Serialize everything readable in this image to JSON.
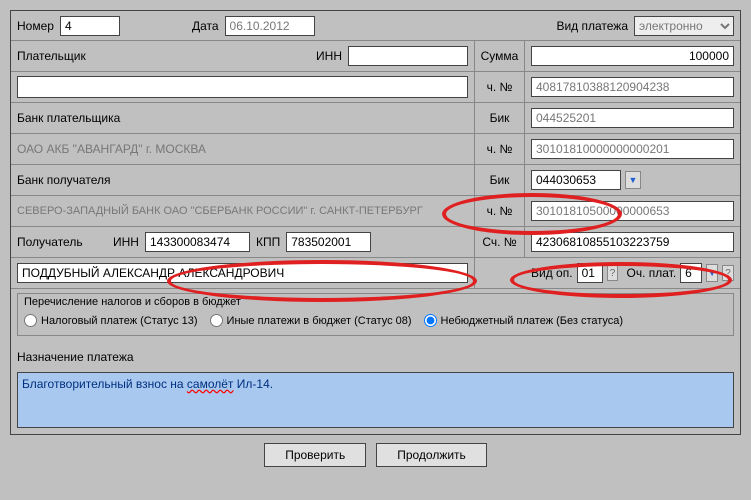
{
  "header": {
    "number_label": "Номер",
    "number": "4",
    "date_label": "Дата",
    "date": "06.10.2012",
    "type_label": "Вид платежа",
    "type": "электронно",
    "type_options": [
      "электронно"
    ]
  },
  "payer": {
    "label": "Плательщик",
    "inn_label": "ИНН",
    "inn": "",
    "amount_label": "Сумма",
    "amount": "100000",
    "account_label": "ч. №",
    "account": "40817810388120904238"
  },
  "payer_bank": {
    "label": "Банк плательщика",
    "name": "ОАО АКБ \"АВАНГАРД\" г. МОСКВА",
    "bik_label": "Бик",
    "bik": "044525201",
    "account_label": "ч. №",
    "account": "30101810000000000201"
  },
  "recipient_bank": {
    "label": "Банк получателя",
    "name": "СЕВЕРО-ЗАПАДНЫЙ БАНК ОАО \"СБЕРБАНК РОССИИ\" г. САНКТ-ПЕТЕРБУРГ",
    "bik_label": "Бик",
    "bik": "044030653",
    "account_label": "ч. №",
    "account": "30101810500000000653"
  },
  "recipient": {
    "label": "Получатель",
    "inn_label": "ИНН",
    "inn": "143300083474",
    "kpp_label": "КПП",
    "kpp": "783502001",
    "account_label": "Сч. №",
    "account": "42306810855103223759",
    "name": "ПОДДУБНЫЙ АЛЕКСАНДР АЛЕКСАНДРОВИЧ",
    "vid_op_label": "Вид оп.",
    "vid_op": "01",
    "och_plat_label": "Оч. плат.",
    "och_plat": "6"
  },
  "tax": {
    "group_label": "Перечисление налогов и сборов в бюджет",
    "opt1": "Налоговый платеж (Статус 13)",
    "opt2": "Иные платежи в бюджет (Статус 08)",
    "opt3": "Небюджетный платеж (Без статуса)"
  },
  "purpose": {
    "label": "Назначение платежа",
    "text_prefix": "Благотворительный взнос на ",
    "text_underlined": "самолёт",
    "text_suffix": " Ил-14."
  },
  "buttons": {
    "check": "Проверить",
    "continue": "Продолжить"
  }
}
